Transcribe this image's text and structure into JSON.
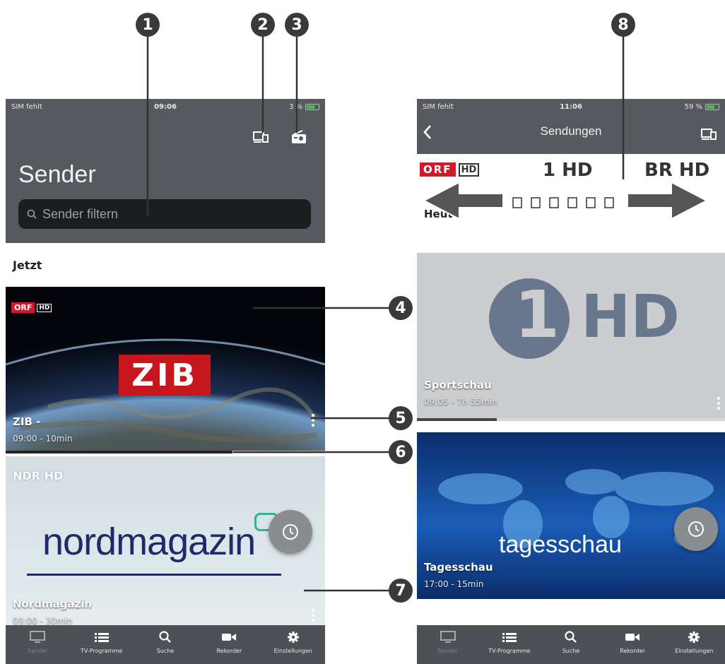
{
  "left": {
    "status": {
      "carrier": "SIM fehlt",
      "time": "09:06",
      "battery": "3 %"
    },
    "header_title": "Sender",
    "search_placeholder": "Sender filtern",
    "section": "Jetzt",
    "cards": [
      {
        "logo": "ORF",
        "logo_hd": "HD",
        "program_logo": "ZIB",
        "title": "ZIB -",
        "time": "09:00 - 10min",
        "progress": 0.71
      },
      {
        "logo": "NDR HD",
        "program_logo": "nordmagazin",
        "title": "Nordmagazin",
        "time": "09:00 - 30min"
      }
    ]
  },
  "right": {
    "status": {
      "carrier": "SIM fehlt",
      "time": "11:06",
      "battery": "59 %"
    },
    "nav_title": "Sendungen",
    "channels": [
      "ORF",
      "1 HD",
      "BR HD"
    ],
    "section": "Heute",
    "cards": [
      {
        "title": "Sportschau",
        "time": "09:05 - 7h 55min",
        "progress": 0.26
      },
      {
        "program_logo": "tagesschau",
        "title": "Tagesschau",
        "time": "17:00 - 15min"
      }
    ]
  },
  "tabs": [
    {
      "label": "Sender",
      "icon": "tv-icon",
      "active": true
    },
    {
      "label": "TV-Programme",
      "icon": "list-icon"
    },
    {
      "label": "Suche",
      "icon": "search-icon"
    },
    {
      "label": "Rekorder",
      "icon": "camera-icon"
    },
    {
      "label": "Einstellungen",
      "icon": "gear-icon"
    }
  ],
  "callouts": [
    "1",
    "2",
    "3",
    "4",
    "5",
    "6",
    "7",
    "8"
  ],
  "colors": {
    "header": "#565a5e",
    "tabbar": "#4d5155",
    "search": "#1b1d1f",
    "orf_red": "#d0192b",
    "callout": "#3a3a3a"
  }
}
